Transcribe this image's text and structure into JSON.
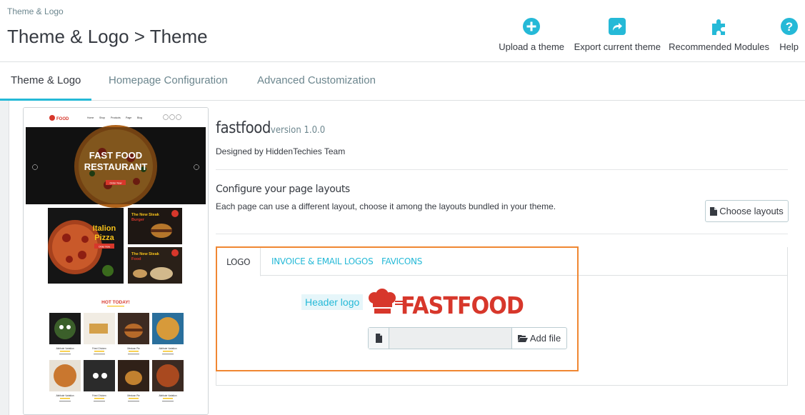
{
  "header": {
    "breadcrumb": "Theme & Logo",
    "title": "Theme & Logo > Theme",
    "toolbar": [
      {
        "label": "Upload a theme",
        "icon": "plus-circle-icon"
      },
      {
        "label": "Export current theme",
        "icon": "share-icon"
      },
      {
        "label": "Recommended Modules",
        "icon": "puzzle-icon"
      },
      {
        "label": "Help",
        "icon": "help-icon"
      }
    ]
  },
  "tabs": [
    {
      "label": "Theme & Logo",
      "active": true
    },
    {
      "label": "Homepage Configuration",
      "active": false
    },
    {
      "label": "Advanced Customization",
      "active": false
    }
  ],
  "theme": {
    "name": "fastfood",
    "version": "version 1.0.0",
    "designer": "Designed by HiddenTechies Team"
  },
  "layouts": {
    "title": "Configure your page layouts",
    "description": "Each page can use a different layout, choose it among the layouts bundled in your theme.",
    "button": "Choose layouts"
  },
  "logo_tabs": [
    {
      "label": "LOGO",
      "active": true
    },
    {
      "label": "INVOICE & EMAIL LOGOS",
      "active": false
    },
    {
      "label": "FAVICONS",
      "active": false
    }
  ],
  "logo": {
    "label": "Header logo",
    "brand_text": "FASTFOOD",
    "add_file": "Add file"
  },
  "preview": {
    "brand": "FOOD",
    "nav": [
      "Home",
      "Shop",
      "Products",
      "Page",
      "Blog"
    ],
    "hero_title_1": "FAST FOOD",
    "hero_title_2": "RESTAURANT",
    "hero_button": "Order Now",
    "promo_1": "Italion",
    "promo_2": "Pizza",
    "promo_btn": "Order Now",
    "promo_3": "The New Steak",
    "promo_3b": "Burger",
    "promo_4": "The New Steak",
    "promo_4b": "Food",
    "hot_today": "HOT TODAY!",
    "products": [
      {
        "name": "Attribute Variation"
      },
      {
        "name": "Fried Chicken"
      },
      {
        "name": "Mexican Pie"
      },
      {
        "name": "Attribute Variation"
      },
      {
        "name": "Attribute Variation"
      },
      {
        "name": "Fried Chicken"
      },
      {
        "name": "Mexican Pie"
      },
      {
        "name": "Attribute Variation"
      }
    ]
  },
  "colors": {
    "accent": "#25b9d7",
    "highlight": "#f08732",
    "brand_red": "#d7372b"
  }
}
